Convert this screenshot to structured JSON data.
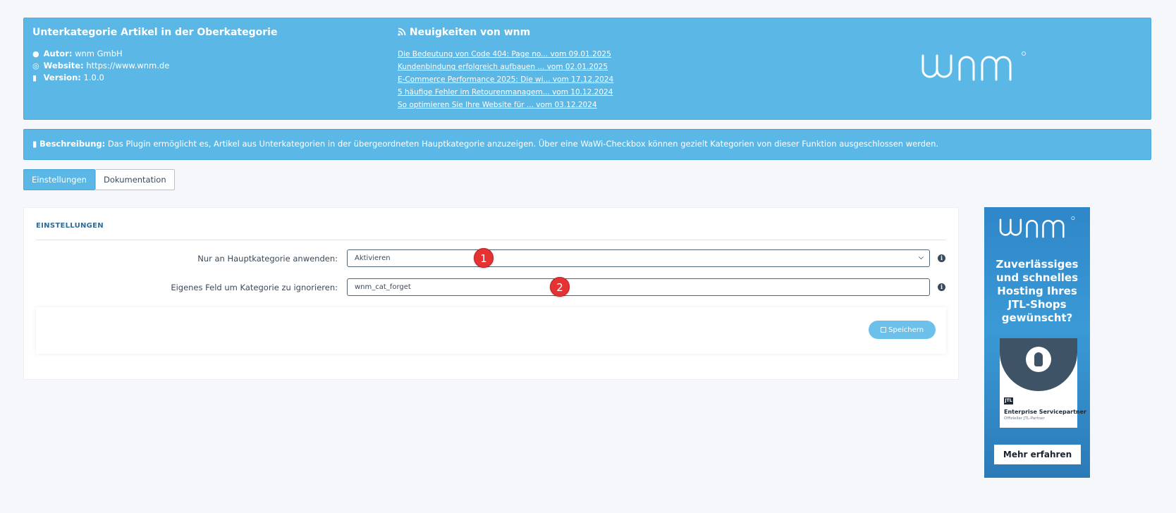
{
  "header": {
    "title": "Unterkategorie Artikel in der Oberkategorie",
    "author_label": "Autor:",
    "author": "wnm GmbH",
    "website_label": "Website:",
    "website": "https://www.wnm.de",
    "version_label": "Version:",
    "version": "1.0.0",
    "news_title": "Neuigkeiten von wnm",
    "news": [
      {
        "text": "Die Bedeutung von Code 404: Page no... vom 09.01.2025"
      },
      {
        "text": "Kundenbindung erfolgreich aufbauen ... vom 02.01.2025"
      },
      {
        "text": "E-Commerce Performance 2025: Die wi... vom 17.12.2024"
      },
      {
        "text": "5 häufige Fehler im Retourenmanagem... vom 10.12.2024"
      },
      {
        "text": "So optimieren Sie Ihre Website für ... vom 03.12.2024"
      }
    ],
    "logo_text": "wnm"
  },
  "description": {
    "label": "Beschreibung:",
    "text": "Das Plugin ermöglicht es, Artikel aus Unterkategorien in der übergeordneten Hauptkategorie anzuzeigen. Über eine WaWi-Checkbox können gezielt Kategorien von dieser Funktion ausgeschlossen werden."
  },
  "tabs": [
    {
      "label": "Einstellungen",
      "active": true
    },
    {
      "label": "Dokumentation",
      "active": false
    }
  ],
  "settings": {
    "section_title": "EINSTELLUNGEN",
    "rows": [
      {
        "label": "Nur an Hauptkategorie anwenden:",
        "value": "Aktivieren",
        "type": "select"
      },
      {
        "label": "Eigenes Feld um Kategorie zu ignorieren:",
        "value": "wnm_cat_forget",
        "type": "text"
      }
    ],
    "save_label": "Speichern",
    "markers": [
      "1",
      "2"
    ]
  },
  "ad": {
    "headline": "Zuverlässiges und schnelles Hosting Ihres JTL-Shops gewünscht?",
    "badge_mark": "JTL",
    "badge_title": "Enterprise Servicepartner",
    "badge_sub": "Offizieller JTL-Partner",
    "cta": "Mehr erfahren"
  },
  "colors": {
    "accent": "#5bb8e6",
    "marker": "#e63232",
    "text": "#3b4a5a"
  }
}
